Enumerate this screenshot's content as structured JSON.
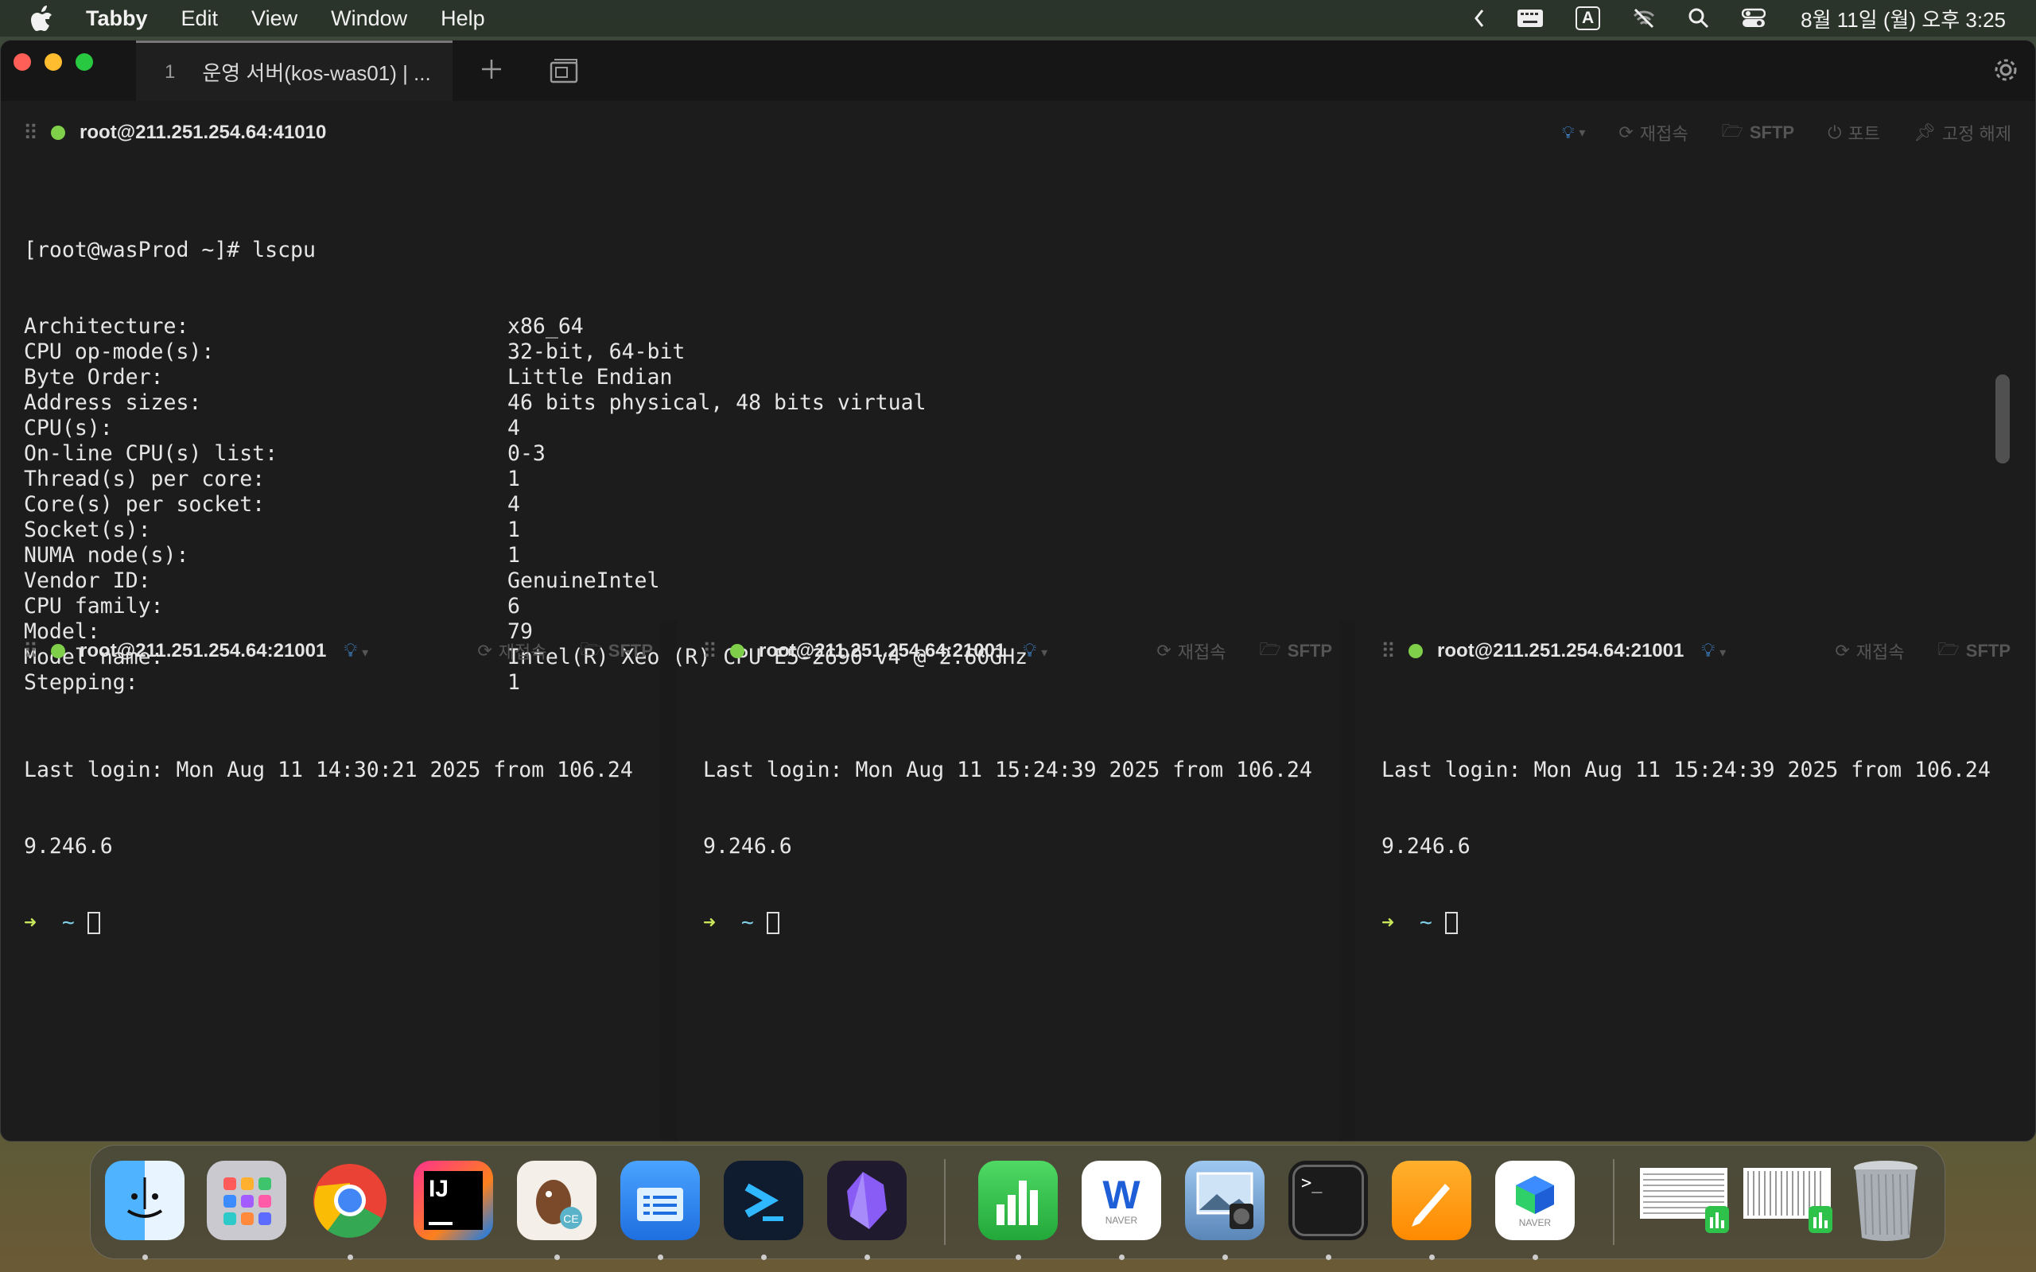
{
  "menubar": {
    "app_name": "Tabby",
    "menus": [
      "Edit",
      "View",
      "Window",
      "Help"
    ],
    "input_indicator": "A",
    "clock": "8월 11일 (월) 오후 3:25"
  },
  "window": {
    "tab_number": "1",
    "tab_title": "운영 서버(kos-was01) | ..."
  },
  "top_pane": {
    "host": "root@211.251.254.64:41010",
    "actions": {
      "reconnect": "재접속",
      "sftp": "SFTP",
      "ports": "포트",
      "unpin": "고정 해제"
    },
    "prompt_line": "[root@wasProd ~]# lscpu",
    "rows": [
      {
        "key": "Architecture:",
        "value": "x86_64"
      },
      {
        "key": "CPU op-mode(s):",
        "value": "32-bit, 64-bit"
      },
      {
        "key": "Byte Order:",
        "value": "Little Endian"
      },
      {
        "key": "Address sizes:",
        "value": "46 bits physical, 48 bits virtual"
      },
      {
        "key": "CPU(s):",
        "value": "4"
      },
      {
        "key": "On-line CPU(s) list:",
        "value": "0-3"
      },
      {
        "key": "Thread(s) per core:",
        "value": "1"
      },
      {
        "key": "Core(s) per socket:",
        "value": "4"
      },
      {
        "key": "Socket(s):",
        "value": "1"
      },
      {
        "key": "NUMA node(s):",
        "value": "1"
      },
      {
        "key": "Vendor ID:",
        "value": "GenuineIntel"
      },
      {
        "key": "CPU family:",
        "value": "6"
      },
      {
        "key": "Model:",
        "value": "79"
      },
      {
        "key": "Model name:",
        "value": "Intel(R) Xeon(R) CPU E5-2690 v4 @ 2.60GHz"
      },
      {
        "key": "Stepping:",
        "value": "1"
      }
    ]
  },
  "bottom_panes": [
    {
      "host": "root@211.251.254.64:21001",
      "reconnect": "재접속",
      "sftp": "SFTP",
      "line1": "Last login: Mon Aug 11 14:30:21 2025 from 106.24",
      "line2": "9.246.6",
      "prompt_arrow": "➜",
      "prompt_dir": "~"
    },
    {
      "host": "root@211.251.254.64:21001",
      "reconnect": "재접속",
      "sftp": "SFTP",
      "line1": "Last login: Mon Aug 11 15:24:39 2025 from 106.24",
      "line2": "9.246.6",
      "prompt_arrow": "➜",
      "prompt_dir": "~"
    },
    {
      "host": "root@211.251.254.64:21001",
      "reconnect": "재접속",
      "sftp": "SFTP",
      "line1": "Last login: Mon Aug 11 15:24:39 2025 from 106.24",
      "line2": "9.246.6",
      "prompt_arrow": "➜",
      "prompt_dir": "~"
    }
  ],
  "dock": {
    "apps": [
      "finder-icon",
      "launchpad-icon",
      "chrome-icon",
      "intellij-icon",
      "dbeaver-icon",
      "file-manager-icon",
      "vscode-like-icon",
      "obsidian-icon",
      "numbers-icon",
      "naver-whale-icon",
      "preview-icon",
      "terminal-icon",
      "pages-icon",
      "naver-app-icon",
      "recent-doc-1-icon",
      "recent-doc-2-icon",
      "trash-icon"
    ],
    "labels": {
      "ce_badge": "CE",
      "naver": "NAVER",
      "terminal_prompt": ">_",
      "intellij": "IJ"
    }
  },
  "colors": {
    "status_green": "#7fcf4b",
    "accent_blue": "#4aa3ff",
    "prompt_arrow": "#c8e65a",
    "prompt_dir": "#7fd0e8"
  }
}
